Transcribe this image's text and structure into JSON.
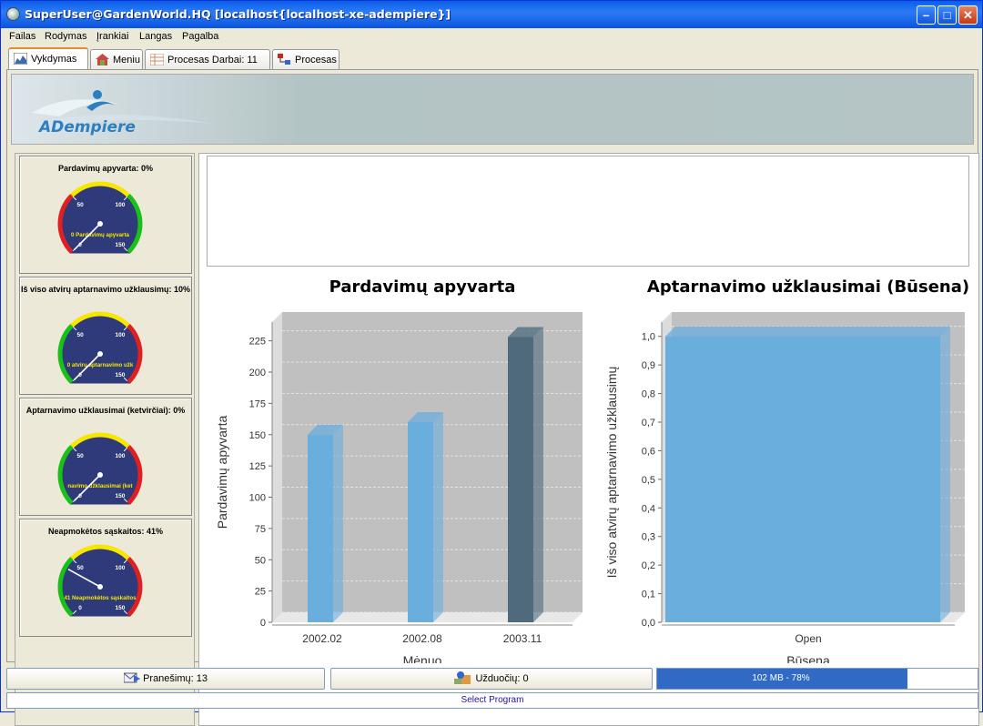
{
  "window": {
    "title": "SuperUser@GardenWorld.HQ [localhost{localhost-xe-adempiere}]"
  },
  "menu": [
    "Failas",
    "Rodymas",
    "Įrankiai",
    "Langas",
    "Pagalba"
  ],
  "tabs": [
    {
      "label": "Vykdymas",
      "icon": "chart-icon",
      "active": true
    },
    {
      "label": "Meniu",
      "icon": "home-icon"
    },
    {
      "label": "Procesas  Darbai: 11",
      "icon": "table-icon"
    },
    {
      "label": "Procesas",
      "icon": "workflow-icon"
    }
  ],
  "banner": {
    "logo_text": "ADempiere"
  },
  "gauges": [
    {
      "title": "Pardavimų apyvarta: 0%",
      "center_label": "0 Pardavimų apyvarta",
      "value": 0,
      "ticks": [
        "0",
        "50",
        "100",
        "150"
      ],
      "scheme": "green-high"
    },
    {
      "title": "Iš viso atvirų aptarnavimo užklausimų: 10%",
      "center_label": "0 atvirų aptarnavimo užk",
      "value": 0,
      "ticks": [
        "0",
        "50",
        "100",
        "150"
      ],
      "scheme": "red-high"
    },
    {
      "title": "Aptarnavimo užklausimai (ketvirčiai): 0%",
      "center_label": "navimo užklausimai (ket",
      "value": 0,
      "ticks": [
        "0",
        "50",
        "100",
        "150"
      ],
      "scheme": "red-high"
    },
    {
      "title": "Neapmokėtos sąskaitos: 41%",
      "center_label": "41 Neapmokėtos sąskaitos",
      "value": 41,
      "ticks": [
        "0",
        "50",
        "100",
        "150"
      ],
      "scheme": "red-high"
    }
  ],
  "chart_data": [
    {
      "type": "bar",
      "title": "Pardavimų apyvarta",
      "xlabel": "Mėnuo",
      "ylabel": "Pardavimų apyvarta",
      "categories": [
        "2002.02",
        "2002.08",
        "2003.11"
      ],
      "values": [
        150,
        160,
        228
      ],
      "colors": [
        "#6aaede",
        "#6aaede",
        "#4e6a7c"
      ],
      "yticks": [
        "0",
        "25",
        "50",
        "75",
        "100",
        "125",
        "150",
        "175",
        "200",
        "225"
      ],
      "ylim": [
        0,
        240
      ],
      "grid": true
    },
    {
      "type": "bar",
      "title": "Aptarnavimo užklausimai (Būsena)",
      "xlabel": "Būsena",
      "ylabel": "Iš viso atvirų aptarnavimo užklausimų",
      "categories": [
        "Open"
      ],
      "values": [
        1.0
      ],
      "colors": [
        "#6aaede"
      ],
      "yticks": [
        "0,0",
        "0,1",
        "0,2",
        "0,3",
        "0,4",
        "0,5",
        "0,6",
        "0,7",
        "0,8",
        "0,9",
        "1,0"
      ],
      "ylim": [
        0,
        1.05
      ],
      "grid": true
    }
  ],
  "status": {
    "messages_label": "Pranešimų: 13",
    "tasks_label": "Užduočių: 0",
    "memory_label": "102 MB - 78%",
    "memory_percent": 78,
    "footer": "Select Program"
  }
}
